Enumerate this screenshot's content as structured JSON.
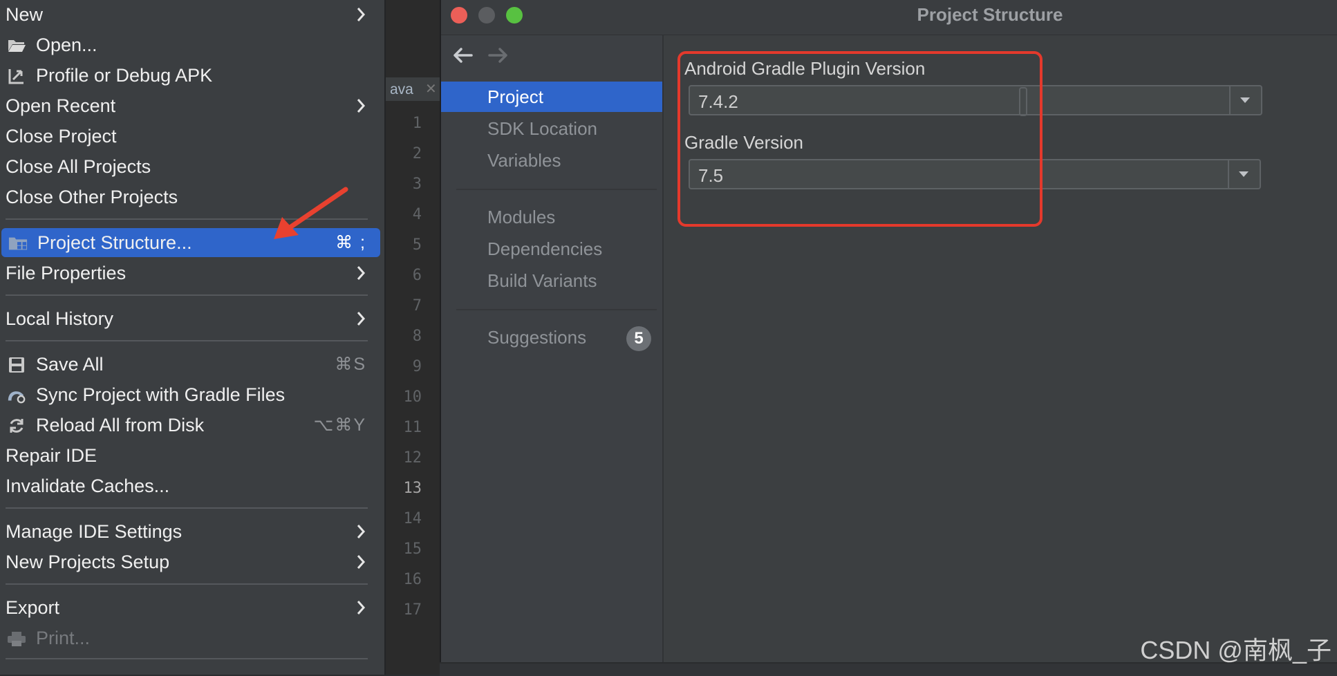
{
  "file_menu": {
    "items": [
      {
        "label": "New",
        "submenu": true
      },
      {
        "label": "Open...",
        "icon": "folder-open-icon"
      },
      {
        "label": "Profile or Debug APK",
        "icon": "profile-apk-icon"
      },
      {
        "label": "Open Recent",
        "submenu": true
      },
      {
        "label": "Close Project"
      },
      {
        "label": "Close All Projects"
      },
      {
        "label": "Close Other Projects"
      },
      {
        "label": "Project Structure...",
        "icon": "project-structure-icon",
        "shortcut": "⌘ ;",
        "selected": true
      },
      {
        "label": "File Properties",
        "submenu": true
      },
      {
        "label": "Local History",
        "submenu": true
      },
      {
        "label": "Save All",
        "icon": "save-icon",
        "shortcut": "⌘S"
      },
      {
        "label": "Sync Project with Gradle Files",
        "icon": "gradle-sync-icon"
      },
      {
        "label": "Reload All from Disk",
        "icon": "reload-icon",
        "shortcut": "⌥⌘Y"
      },
      {
        "label": "Repair IDE"
      },
      {
        "label": "Invalidate Caches..."
      },
      {
        "label": "Manage IDE Settings",
        "submenu": true
      },
      {
        "label": "New Projects Setup",
        "submenu": true
      },
      {
        "label": "Export",
        "submenu": true
      },
      {
        "label": "Print...",
        "icon": "print-icon",
        "disabled": true
      }
    ]
  },
  "editor": {
    "tab_label": "ava",
    "line_numbers": [
      "1",
      "2",
      "3",
      "4",
      "5",
      "6",
      "7",
      "8",
      "9",
      "10",
      "11",
      "12",
      "13",
      "14",
      "15",
      "16",
      "17"
    ],
    "current_line": "13"
  },
  "project_structure": {
    "title": "Project Structure",
    "nav": {
      "items": [
        {
          "label": "Project",
          "selected": true
        },
        {
          "label": "SDK Location"
        },
        {
          "label": "Variables"
        },
        {
          "label": "Modules"
        },
        {
          "label": "Dependencies"
        },
        {
          "label": "Build Variants"
        },
        {
          "label": "Suggestions",
          "badge": "5"
        }
      ]
    },
    "fields": {
      "agp_label": "Android Gradle Plugin Version",
      "agp_value": "7.4.2",
      "gradle_label": "Gradle Version",
      "gradle_value": "7.5"
    }
  },
  "watermark": "CSDN @南枫_子",
  "colors": {
    "selection": "#2f65ca",
    "highlight_box": "#e4392c",
    "arrow": "#e8412f"
  }
}
